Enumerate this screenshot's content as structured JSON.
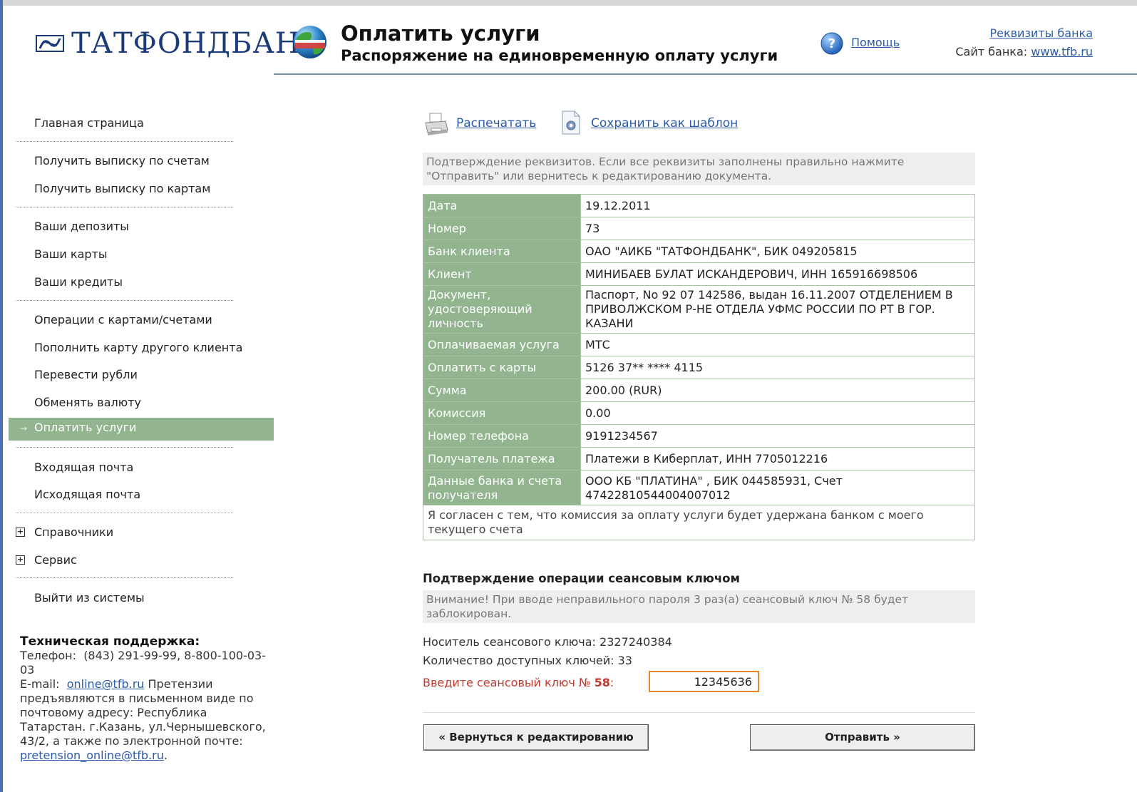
{
  "header": {
    "logo_text": "ТАТФОНДБАНК",
    "title": "Оплатить услуги",
    "subtitle": "Распоряжение на единовременную оплату услуги",
    "help_label": "Помощь",
    "bank_details_link": "Реквизиты банка",
    "site_label": "Сайт банка:",
    "site_link": "www.tfb.ru"
  },
  "sidebar": {
    "items": [
      {
        "label": "Главная страница"
      },
      {
        "label": "Получить выписку по счетам"
      },
      {
        "label": "Получить выписку по картам"
      },
      {
        "label": "Ваши депозиты"
      },
      {
        "label": "Ваши карты"
      },
      {
        "label": "Ваши кредиты"
      },
      {
        "label": "Операции с картами/счетами"
      },
      {
        "label": "Пополнить карту другого клиента"
      },
      {
        "label": "Перевести рубли"
      },
      {
        "label": "Обменять валюту"
      },
      {
        "label": "Оплатить услуги"
      },
      {
        "label": "Входящая почта"
      },
      {
        "label": "Исходящая почта"
      },
      {
        "label": "Справочники"
      },
      {
        "label": "Сервис"
      },
      {
        "label": "Выйти из системы"
      }
    ],
    "active_arrow": "→"
  },
  "support": {
    "title": "Техническая поддержка:",
    "phone_label": "Телефон:",
    "phone": "(843) 291-99-99, 8-800-100-03-03",
    "email_label": "E-mail:",
    "email": "online@tfb.ru",
    "claims_text": "Претензии предъявляются в письменном виде по почтовому адресу: Республика Татарстан. г.Казань, ул.Чернышевского, 43/2, а также по электронной почте:",
    "claims_email": "pretension_online@tfb.ru"
  },
  "toolbar": {
    "print_label": "Распечатать",
    "save_template_label": "Сохранить как шаблон"
  },
  "confirm_note": "Подтверждение реквизитов. Если все реквизиты заполнены правильно нажмите \"Отправить\" или вернитесь к редактированию документа.",
  "details": [
    {
      "key": "Дата",
      "value": "19.12.2011"
    },
    {
      "key": "Номер",
      "value": "73"
    },
    {
      "key": "Банк клиента",
      "value": " ОАО \"АИКБ \"ТАТФОНДБАНК\", БИК 049205815"
    },
    {
      "key": "Клиент",
      "value": "МИНИБАЕВ БУЛАТ ИСКАНДЕРОВИЧ, ИНН 165916698506"
    },
    {
      "key": "Документ, удостоверяющий личность",
      "value": "Паспорт, No 92 07 142586, выдан 16.11.2007 ОТДЕЛЕНИЕМ В ПРИВОЛЖСКОМ Р-НЕ ОТДЕЛА УФМС РОССИИ ПО РТ В ГОР. КАЗАНИ"
    },
    {
      "key": "Оплачиваемая услуга",
      "value": "МТС"
    },
    {
      "key": "Оплатить с карты",
      "value": "5126 37** **** 4115"
    },
    {
      "key": "Сумма",
      "value": "200.00  (RUR)"
    },
    {
      "key": "Комиссия",
      "value": "0.00"
    },
    {
      "key": "Номер телефона",
      "value": "9191234567"
    },
    {
      "key": "Получатель платежа",
      "value": "Платежи в Киберплат, ИНН 7705012216"
    },
    {
      "key": "Данные банка и счета получателя",
      "value": "ООО КБ \"ПЛАТИНА\" , БИК 044585931, Счет 47422810544004007012"
    }
  ],
  "agreement": "Я согласен с тем, что комиссия за оплату услуги будет удержана банком с моего текущего счета",
  "session": {
    "title": "Подтверждение операции сеансовым ключом",
    "warning": "Внимание! При вводе неправильного пароля 3 раз(а) сеансовый ключ № 58 будет заблокирован.",
    "carrier": "Носитель сеансового ключа: 2327240384",
    "available": "Количество доступных ключей: 33",
    "enter_label": "Введите сеансовый ключ №",
    "key_number": "58",
    "enter_suffix": ":",
    "key_value": "12345636"
  },
  "buttons": {
    "back": "« Вернуться к редактированию",
    "send": "Отправить »"
  },
  "colors": {
    "accent_green": "#92b58f",
    "link_blue": "#2b5aa8",
    "warning_red": "#c0392b",
    "input_border": "#e08a2e"
  }
}
